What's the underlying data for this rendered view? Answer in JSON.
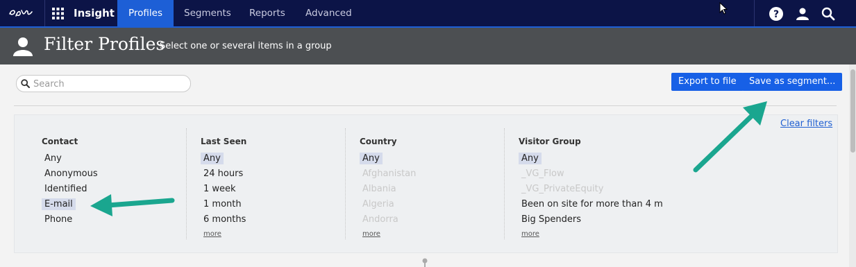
{
  "nav": {
    "logo_icon": "episerver-logo-icon",
    "apps_icon": "apps-grid-icon",
    "app_name": "Insight",
    "tabs": [
      {
        "label": "Profiles",
        "active": true
      },
      {
        "label": "Segments",
        "active": false
      },
      {
        "label": "Reports",
        "active": false
      },
      {
        "label": "Advanced",
        "active": false
      }
    ],
    "icons": [
      "help-icon",
      "user-icon",
      "search-icon"
    ]
  },
  "header": {
    "title": "Filter Profiles",
    "subtitle": "Select one or several items in a group"
  },
  "search": {
    "placeholder": "Search",
    "value": ""
  },
  "buttons": {
    "export": "Export to file",
    "save_segment": "Save as segment..."
  },
  "filters": {
    "clear_label": "Clear filters",
    "more_label": "more",
    "columns": [
      {
        "title": "Contact",
        "options": [
          {
            "label": "Any",
            "selected": false,
            "disabled": false
          },
          {
            "label": "Anonymous",
            "selected": false,
            "disabled": false
          },
          {
            "label": "Identified",
            "selected": false,
            "disabled": false
          },
          {
            "label": "E-mail",
            "selected": true,
            "disabled": false
          },
          {
            "label": "Phone",
            "selected": false,
            "disabled": false
          }
        ],
        "more": false
      },
      {
        "title": "Last Seen",
        "options": [
          {
            "label": "Any",
            "selected": true,
            "disabled": false
          },
          {
            "label": "24 hours",
            "selected": false,
            "disabled": false
          },
          {
            "label": "1 week",
            "selected": false,
            "disabled": false
          },
          {
            "label": "1 month",
            "selected": false,
            "disabled": false
          },
          {
            "label": "6 months",
            "selected": false,
            "disabled": false
          }
        ],
        "more": true
      },
      {
        "title": "Country",
        "options": [
          {
            "label": "Any",
            "selected": true,
            "disabled": false
          },
          {
            "label": "Afghanistan",
            "selected": false,
            "disabled": true
          },
          {
            "label": "Albania",
            "selected": false,
            "disabled": true
          },
          {
            "label": "Algeria",
            "selected": false,
            "disabled": true
          },
          {
            "label": "Andorra",
            "selected": false,
            "disabled": true
          }
        ],
        "more": true
      },
      {
        "title": "Visitor Group",
        "options": [
          {
            "label": "Any",
            "selected": true,
            "disabled": false
          },
          {
            "label": "_VG_Flow",
            "selected": false,
            "disabled": true
          },
          {
            "label": "_VG_PrivateEquity",
            "selected": false,
            "disabled": true
          },
          {
            "label": "Been on site for more than 4 m",
            "selected": false,
            "disabled": false
          },
          {
            "label": "Big Spenders",
            "selected": false,
            "disabled": false
          }
        ],
        "more": true
      }
    ]
  },
  "colors": {
    "nav_bg": "#0c1447",
    "accent": "#1d5fd6",
    "header_bg": "#4c4f52",
    "annotation_arrow": "#1aa68f",
    "selected_bg": "#d5dbeb"
  }
}
